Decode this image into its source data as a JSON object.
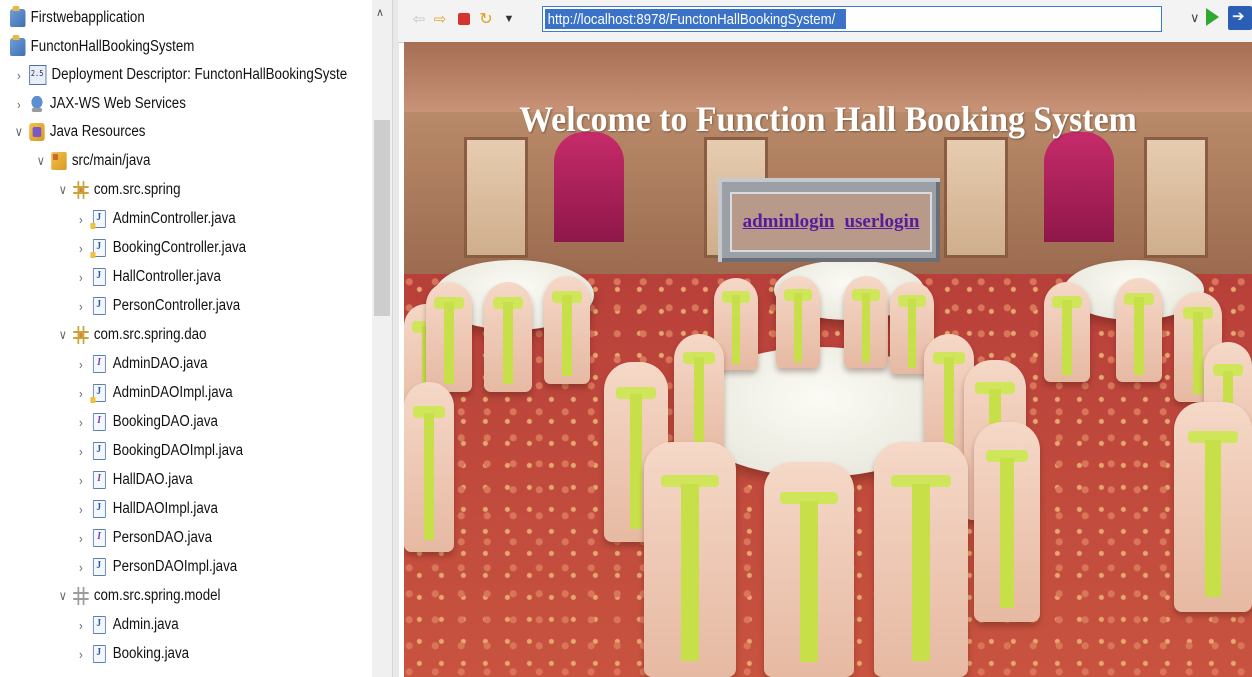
{
  "explorer": {
    "items": [
      {
        "label": "Firstwebapplication",
        "icon": "project-icon",
        "chevron": ""
      },
      {
        "label": "FunctonHallBookingSystem",
        "icon": "project-icon",
        "chevron": ""
      },
      {
        "label": "Deployment Descriptor: FunctonHallBookingSyste",
        "icon": "deployment-descriptor-icon",
        "chevron": "›"
      },
      {
        "label": "JAX-WS Web Services",
        "icon": "web-services-icon",
        "chevron": "›"
      },
      {
        "label": "Java Resources",
        "icon": "java-resources-icon",
        "chevron": "∨"
      },
      {
        "label": "src/main/java",
        "icon": "source-folder-icon",
        "chevron": "∨"
      },
      {
        "label": "com.src.spring",
        "icon": "package-icon",
        "chevron": "∨"
      },
      {
        "label": "AdminController.java",
        "icon": "java-file-icon",
        "chevron": "›"
      },
      {
        "label": "BookingController.java",
        "icon": "java-file-icon",
        "chevron": "›"
      },
      {
        "label": "HallController.java",
        "icon": "java-file-icon",
        "chevron": "›"
      },
      {
        "label": "PersonController.java",
        "icon": "java-file-icon",
        "chevron": "›"
      },
      {
        "label": "com.src.spring.dao",
        "icon": "package-icon",
        "chevron": "∨"
      },
      {
        "label": "AdminDAO.java",
        "icon": "java-interface-icon",
        "chevron": "›"
      },
      {
        "label": "AdminDAOImpl.java",
        "icon": "java-file-icon",
        "chevron": "›"
      },
      {
        "label": "BookingDAO.java",
        "icon": "java-interface-icon",
        "chevron": "›"
      },
      {
        "label": "BookingDAOImpl.java",
        "icon": "java-file-icon",
        "chevron": "›"
      },
      {
        "label": "HallDAO.java",
        "icon": "java-interface-icon",
        "chevron": "›"
      },
      {
        "label": "HallDAOImpl.java",
        "icon": "java-file-icon",
        "chevron": "›"
      },
      {
        "label": "PersonDAO.java",
        "icon": "java-interface-icon",
        "chevron": "›"
      },
      {
        "label": "PersonDAOImpl.java",
        "icon": "java-file-icon",
        "chevron": "›"
      },
      {
        "label": "com.src.spring.model",
        "icon": "package-icon",
        "chevron": "∨"
      },
      {
        "label": "Admin.java",
        "icon": "java-file-icon",
        "chevron": "›"
      },
      {
        "label": "Booking.java",
        "icon": "java-file-icon",
        "chevron": "›"
      }
    ]
  },
  "browser": {
    "url": "http://localhost:8978/FunctonHallBookingSystem/",
    "page": {
      "heading": "Welcome to Function Hall Booking System",
      "links": {
        "admin": "adminlogin",
        "user": "userlogin"
      }
    }
  },
  "colors": {
    "url_highlight": "#3a71c9",
    "link": "#5a1a9b",
    "heading": "#ffffff"
  }
}
